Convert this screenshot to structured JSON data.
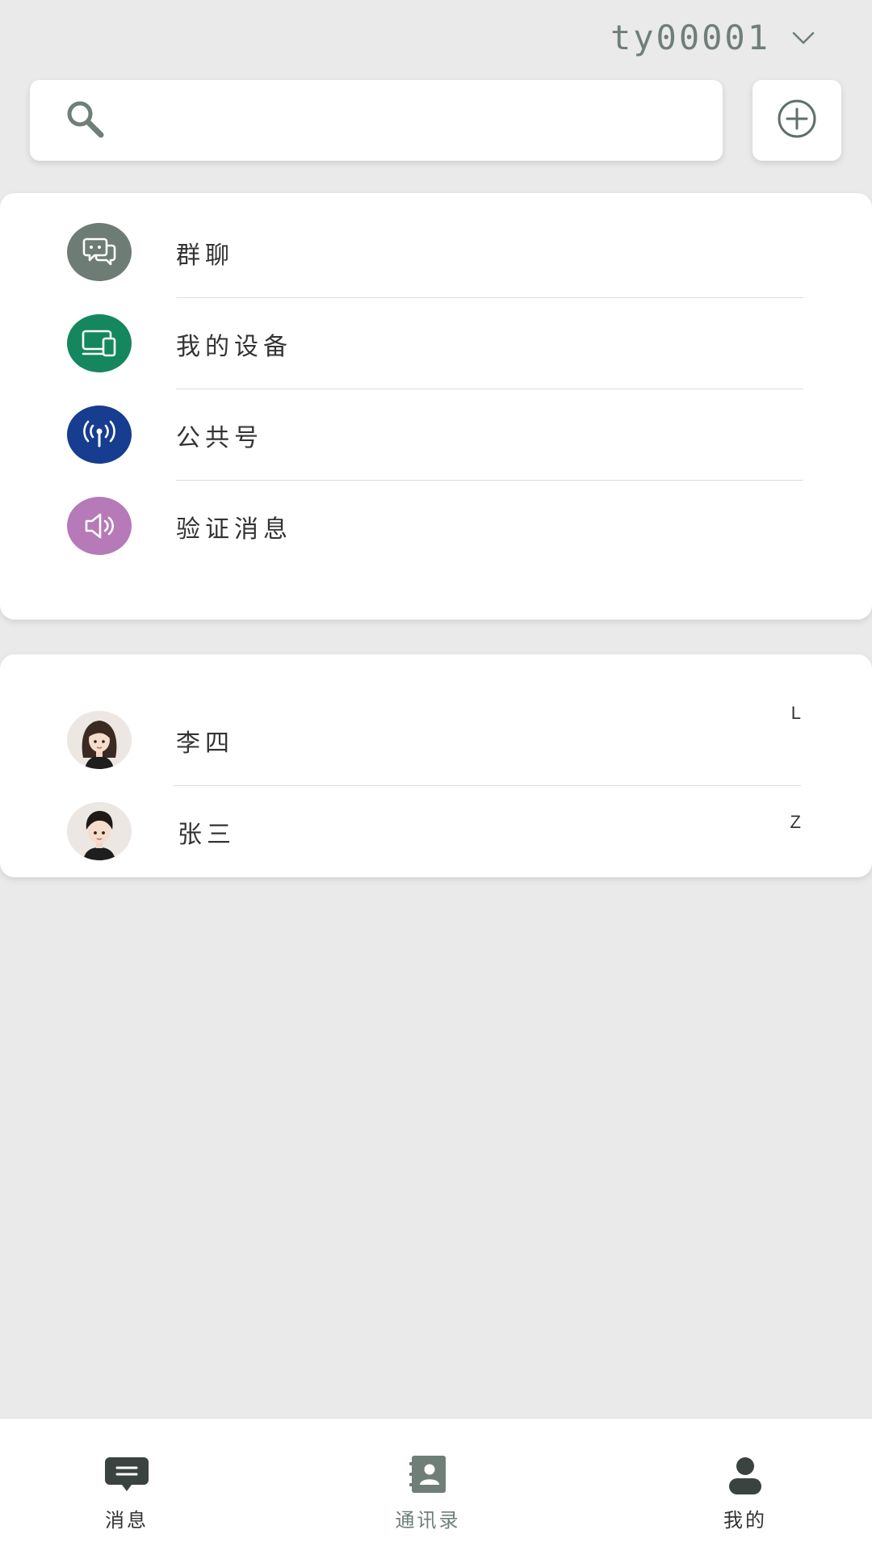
{
  "header": {
    "account_name": "ty00001",
    "chevron_icon": "chevron-down-icon"
  },
  "search": {
    "placeholder": "",
    "value": "",
    "icon": "search-icon"
  },
  "add_button": {
    "icon": "plus-circle-icon"
  },
  "features": [
    {
      "label": "群聊",
      "icon": "chat-bubbles-icon",
      "color": "#6d7c75"
    },
    {
      "label": "我的设备",
      "icon": "devices-icon",
      "color": "#15875f"
    },
    {
      "label": "公共号",
      "icon": "broadcast-icon",
      "color": "#163d8f"
    },
    {
      "label": "验证消息",
      "icon": "speaker-icon",
      "color": "#b57ab7"
    }
  ],
  "contacts": [
    {
      "name": "李四",
      "index": "L",
      "avatar": "avatar-female"
    },
    {
      "name": "张三",
      "index": "Z",
      "avatar": "avatar-male"
    }
  ],
  "nav": {
    "messages": {
      "label": "消息",
      "icon": "message-icon"
    },
    "contacts": {
      "label": "通讯录",
      "icon": "contact-book-icon"
    },
    "me": {
      "label": "我的",
      "icon": "user-icon"
    }
  },
  "colors": {
    "background": "#eaeaea",
    "accent": "#6f7f78",
    "nav_inactive": "#333333"
  }
}
